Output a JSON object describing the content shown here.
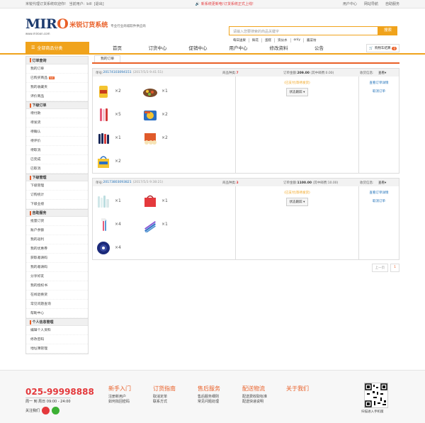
{
  "topbar": {
    "welcome": "米锐代理订货系统欢迎你!",
    "user_prefix": "当前用户:",
    "user": "bill",
    "logout": "[退出]",
    "notice": "新系统更新咯!订货系统正式上线!",
    "links": [
      "用户中心",
      "网站导航",
      "自助服务"
    ]
  },
  "logo": {
    "brand_a": "MIR",
    "brand_b": "O",
    "url": "www.miroon.com",
    "system": "米锐订货系统",
    "slogan": "专业行业商城软件供应商"
  },
  "search": {
    "placeholder": "请输入您要搜索的商品关键字",
    "button": "搜索",
    "hotwords": [
      "每日送果",
      "鲜花",
      "蛋糕",
      "资伙水",
      "only",
      "酱菜坊"
    ]
  },
  "nav": {
    "category": "全部商品分类",
    "items": [
      "首页",
      "订货中心",
      "促销中心",
      "用户中心",
      "修改资料",
      "公告"
    ],
    "cart": "购物车结算",
    "cart_count": "0"
  },
  "sidebar": [
    {
      "title": "订单查询",
      "items": [
        "我的订单",
        "已购买商品",
        "我的收藏夹",
        "评价商品"
      ],
      "hot_index": 1,
      "hot": "hot"
    },
    {
      "title": "下级订单",
      "items": [
        "待付款",
        "待发货",
        "待确认",
        "待评价",
        "待取消",
        "已完成",
        "已取消"
      ]
    },
    {
      "title": "下级管理",
      "items": [
        "下级管理",
        "订购统计",
        "下级业绩"
      ]
    },
    {
      "title": "自助服务",
      "items": [
        "批量订货",
        "账户余额",
        "我的返利",
        "我的优惠券",
        "获取邀请码",
        "我的邀请码",
        "分享好友",
        "我的授权书",
        "在线退换货",
        "常见问题查询",
        "帮助中心"
      ]
    },
    {
      "title": "个人信息管理",
      "items": [
        "编辑个人资料",
        "修改密码",
        "地址簿管理"
      ]
    }
  ],
  "tab": "我的订单",
  "orders": [
    {
      "num_label": "单号:",
      "num": "20174103094151",
      "date": "(2017/5/3 9:41:51)",
      "kinds_label": "商品种类:",
      "kinds": "7",
      "amount_label": "订单金额:",
      "amount": "209.00",
      "shipping": "(其中邮费:0.00)",
      "rate": "收货信息:",
      "view": "查看",
      "status": "(已支付|等待发货)",
      "track": "状态跟踪",
      "ops": [
        "查看订单详情",
        "取消订单"
      ],
      "goods": [
        {
          "icon": "chips",
          "qty": "×2"
        },
        {
          "icon": "snack-box",
          "qty": "×1"
        },
        {
          "icon": "bottles",
          "qty": "×5"
        },
        {
          "icon": "noodles",
          "qty": "×2"
        },
        {
          "icon": "cola",
          "qty": "×1"
        },
        {
          "icon": "biscuit-box",
          "qty": "×2"
        },
        {
          "icon": "gift-bag",
          "qty": "×2"
        }
      ]
    },
    {
      "num_label": "单号:",
      "num": "20173803093821",
      "date": "(2017/5/3 9:38:21)",
      "kinds_label": "商品种类:",
      "kinds": "3",
      "amount_label": "订单金额:",
      "amount": "1100.00",
      "shipping": "(其中邮费:10.00)",
      "rate": "收货信息:",
      "view": "查看",
      "status": "(已支付|等待发货)",
      "track": "状态跟踪",
      "ops": [
        "查看订单详情",
        "取消订单"
      ],
      "goods": [
        {
          "icon": "skincare",
          "qty": "×1"
        },
        {
          "icon": "red-bag",
          "qty": "×1"
        },
        {
          "icon": "toothbrush",
          "qty": "×4"
        },
        {
          "icon": "pens",
          "qty": "×1"
        },
        {
          "icon": "plate",
          "qty": "×4"
        }
      ]
    }
  ],
  "pager": {
    "prev": "上一页",
    "current": "1"
  },
  "footer": {
    "tel": "025-99998888",
    "hours": "周一 到 周日 09:00 - 24:00",
    "follow": "关注我们",
    "cols": [
      {
        "title": "新手入门",
        "items": [
          "注册新用户",
          "如何找回密码"
        ]
      },
      {
        "title": "订货指南",
        "items": [
          "取消定单",
          "联系方式"
        ]
      },
      {
        "title": "售后服务",
        "items": [
          "售后服务细则",
          "常见问题处理"
        ]
      },
      {
        "title": "配送物流",
        "items": [
          "配送费收取标准",
          "配送快递说明"
        ]
      },
      {
        "title": "关于我们",
        "items": []
      }
    ],
    "qr_text": "扫描进入手机版"
  }
}
